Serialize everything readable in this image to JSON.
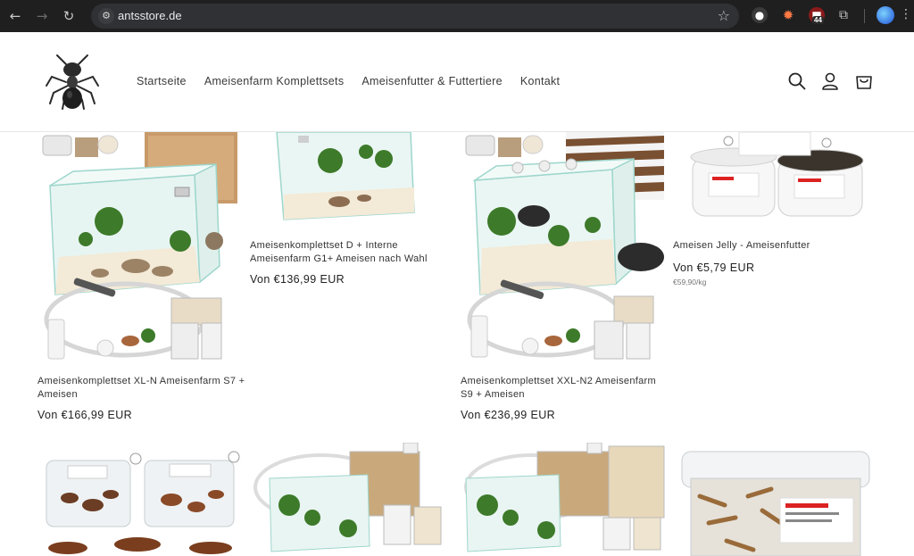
{
  "browser": {
    "url": "antsstore.de",
    "extension_badge": "44"
  },
  "store": {
    "nav": [
      "Startseite",
      "Ameisenfarm Komplettsets",
      "Ameisenfutter & Futtertiere",
      "Kontakt"
    ]
  },
  "products": [
    {
      "title": "Ameisenkomplettset XL-N Ameisenfarm S7 + Ameisen",
      "price": "Von €166,99 EUR"
    },
    {
      "title": "Ameisenkomplettset D + Interne Ameisenfarm G1+ Ameisen nach Wahl",
      "price": "Von €136,99 EUR"
    },
    {
      "title": "Ameisenkomplettset XXL-N2 Ameisenfarm S9 + Ameisen",
      "price": "Von €236,99 EUR"
    },
    {
      "title": "Ameisen Jelly - Ameisenfutter",
      "price": "Von €5,79 EUR",
      "unit_price": "€59,90/kg"
    }
  ],
  "icons": {
    "search": "search-icon",
    "account": "account-icon",
    "cart": "cart-icon"
  }
}
